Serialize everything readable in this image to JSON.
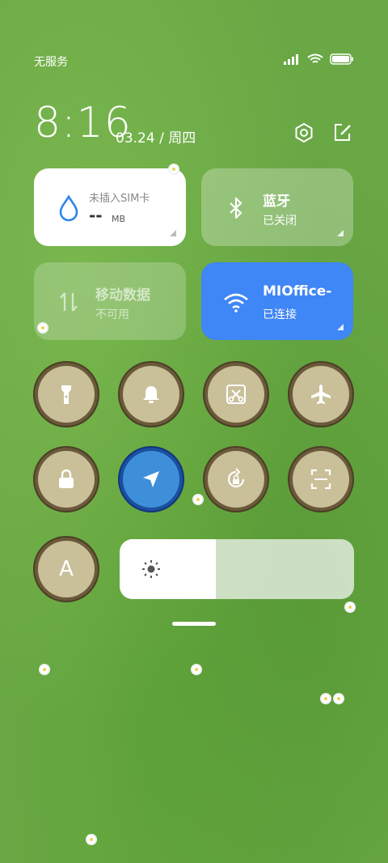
{
  "status": {
    "carrier": "无服务"
  },
  "header": {
    "time": "8:16",
    "date": "03.24 / 周四"
  },
  "tiles": {
    "sim": {
      "title": "未插入SIM卡",
      "value": "--",
      "unit": "MB"
    },
    "bluetooth": {
      "title": "蓝牙",
      "status": "已关闭"
    },
    "mobile_data": {
      "title": "移动数据",
      "status": "不可用"
    },
    "wifi": {
      "title": "MIOffice-",
      "status": "已连接"
    }
  },
  "toggles": [
    "flashlight-icon",
    "bell-icon",
    "screenshot-icon",
    "airplane-icon",
    "lock-icon",
    "location-icon",
    "rotation-lock-icon",
    "scan-icon",
    "font-icon"
  ],
  "round_labels": {
    "font": "A"
  },
  "brightness": {
    "level": 0.41
  },
  "colors": {
    "wifi_tile": "#3f86f7",
    "accent_blue": "#2e87e8",
    "grass": "#6aa845"
  }
}
